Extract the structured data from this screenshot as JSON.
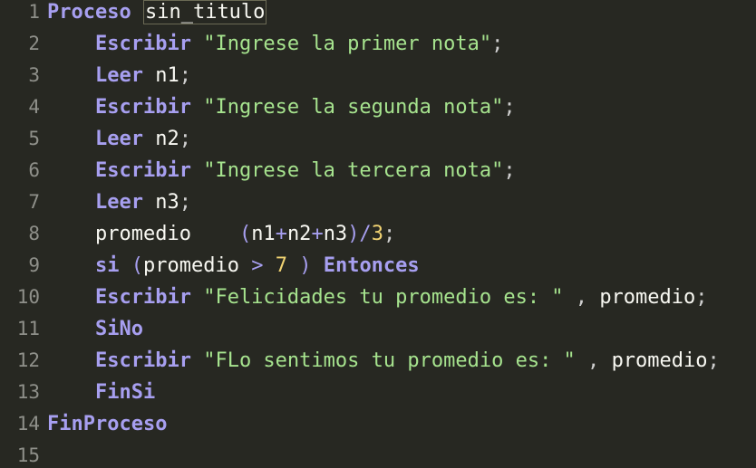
{
  "editor": {
    "lines": [
      {
        "n": "1",
        "tokens": [
          {
            "t": "Proceso",
            "c": "kw"
          },
          {
            "t": " ",
            "c": "id"
          },
          {
            "t": "sin_titulo",
            "c": "id",
            "hl": true
          }
        ]
      },
      {
        "n": "2",
        "tokens": [
          {
            "t": "    ",
            "c": "id"
          },
          {
            "t": "Escribir",
            "c": "kw"
          },
          {
            "t": " ",
            "c": "id"
          },
          {
            "t": "\"Ingrese la primer nota\"",
            "c": "str"
          },
          {
            "t": ";",
            "c": "pn"
          }
        ]
      },
      {
        "n": "3",
        "tokens": [
          {
            "t": "    ",
            "c": "id"
          },
          {
            "t": "Leer",
            "c": "kw"
          },
          {
            "t": " ",
            "c": "id"
          },
          {
            "t": "n1",
            "c": "id"
          },
          {
            "t": ";",
            "c": "pn"
          }
        ]
      },
      {
        "n": "4",
        "tokens": [
          {
            "t": "    ",
            "c": "id"
          },
          {
            "t": "Escribir",
            "c": "kw"
          },
          {
            "t": " ",
            "c": "id"
          },
          {
            "t": "\"Ingrese la segunda nota\"",
            "c": "str"
          },
          {
            "t": ";",
            "c": "pn"
          }
        ]
      },
      {
        "n": "5",
        "tokens": [
          {
            "t": "    ",
            "c": "id"
          },
          {
            "t": "Leer",
            "c": "kw"
          },
          {
            "t": " ",
            "c": "id"
          },
          {
            "t": "n2",
            "c": "id"
          },
          {
            "t": ";",
            "c": "pn"
          }
        ]
      },
      {
        "n": "6",
        "tokens": [
          {
            "t": "    ",
            "c": "id"
          },
          {
            "t": "Escribir",
            "c": "kw"
          },
          {
            "t": " ",
            "c": "id"
          },
          {
            "t": "\"Ingrese la tercera nota\"",
            "c": "str"
          },
          {
            "t": ";",
            "c": "pn"
          }
        ]
      },
      {
        "n": "7",
        "tokens": [
          {
            "t": "    ",
            "c": "id"
          },
          {
            "t": "Leer",
            "c": "kw"
          },
          {
            "t": " ",
            "c": "id"
          },
          {
            "t": "n3",
            "c": "id"
          },
          {
            "t": ";",
            "c": "pn"
          }
        ]
      },
      {
        "n": "8",
        "tokens": [
          {
            "t": "    ",
            "c": "id"
          },
          {
            "t": "promedio",
            "c": "id"
          },
          {
            "t": "    ",
            "c": "id"
          },
          {
            "t": "(",
            "c": "op"
          },
          {
            "t": "n1",
            "c": "id"
          },
          {
            "t": "+",
            "c": "op"
          },
          {
            "t": "n2",
            "c": "id"
          },
          {
            "t": "+",
            "c": "op"
          },
          {
            "t": "n3",
            "c": "id"
          },
          {
            "t": ")/",
            "c": "op"
          },
          {
            "t": "3",
            "c": "num"
          },
          {
            "t": ";",
            "c": "pn"
          }
        ]
      },
      {
        "n": "9",
        "tokens": [
          {
            "t": "    ",
            "c": "id"
          },
          {
            "t": "si",
            "c": "kw"
          },
          {
            "t": " ",
            "c": "id"
          },
          {
            "t": "(",
            "c": "op"
          },
          {
            "t": "promedio",
            "c": "id"
          },
          {
            "t": " > ",
            "c": "op"
          },
          {
            "t": "7",
            "c": "num"
          },
          {
            "t": " ) ",
            "c": "op"
          },
          {
            "t": "Entonces",
            "c": "kw"
          }
        ]
      },
      {
        "n": "10",
        "tokens": [
          {
            "t": "    ",
            "c": "id"
          },
          {
            "t": "Escribir",
            "c": "kw"
          },
          {
            "t": " ",
            "c": "id"
          },
          {
            "t": "\"Felicidades tu promedio es: \"",
            "c": "str"
          },
          {
            "t": " , ",
            "c": "pn"
          },
          {
            "t": "promedio",
            "c": "id"
          },
          {
            "t": ";",
            "c": "pn"
          }
        ]
      },
      {
        "n": "11",
        "tokens": [
          {
            "t": "    ",
            "c": "id"
          },
          {
            "t": "SiNo",
            "c": "kw"
          }
        ]
      },
      {
        "n": "12",
        "tokens": [
          {
            "t": "    ",
            "c": "id"
          },
          {
            "t": "Escribir",
            "c": "kw"
          },
          {
            "t": " ",
            "c": "id"
          },
          {
            "t": "\"FLo sentimos tu promedio es: \"",
            "c": "str"
          },
          {
            "t": " , ",
            "c": "pn"
          },
          {
            "t": "promedio",
            "c": "id"
          },
          {
            "t": ";",
            "c": "pn"
          }
        ]
      },
      {
        "n": "13",
        "tokens": [
          {
            "t": "    ",
            "c": "id"
          },
          {
            "t": "FinSi",
            "c": "kw"
          }
        ]
      },
      {
        "n": "14",
        "tokens": [
          {
            "t": "FinProceso",
            "c": "kw"
          }
        ]
      },
      {
        "n": "15",
        "tokens": []
      }
    ]
  }
}
